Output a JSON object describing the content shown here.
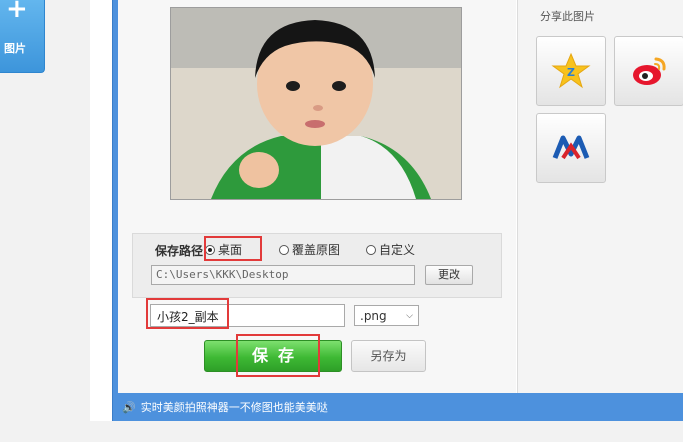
{
  "left_panel": {
    "button_label": "图片"
  },
  "preview": {
    "alt": "preview photo"
  },
  "save_path": {
    "label": "保存路径",
    "options": [
      "桌面",
      "覆盖原图",
      "自定义"
    ],
    "selected": "桌面",
    "path_value": "C:\\Users\\KKK\\Desktop",
    "change_label": "更改"
  },
  "file": {
    "name_value": "小孩2_副本",
    "format_value": ".png"
  },
  "actions": {
    "save_label": "保存",
    "save_as_label": "另存为"
  },
  "share": {
    "title": "分享此图片",
    "targets": [
      "qzone-icon",
      "weibo-icon",
      "renren-icon"
    ]
  },
  "status_bar": {
    "text": "实时美颜拍照神器一不修图也能美美哒"
  },
  "colors": {
    "frame_blue": "#4d91dd",
    "save_green": "#3eb934",
    "highlight_red": "#e23a3a"
  }
}
